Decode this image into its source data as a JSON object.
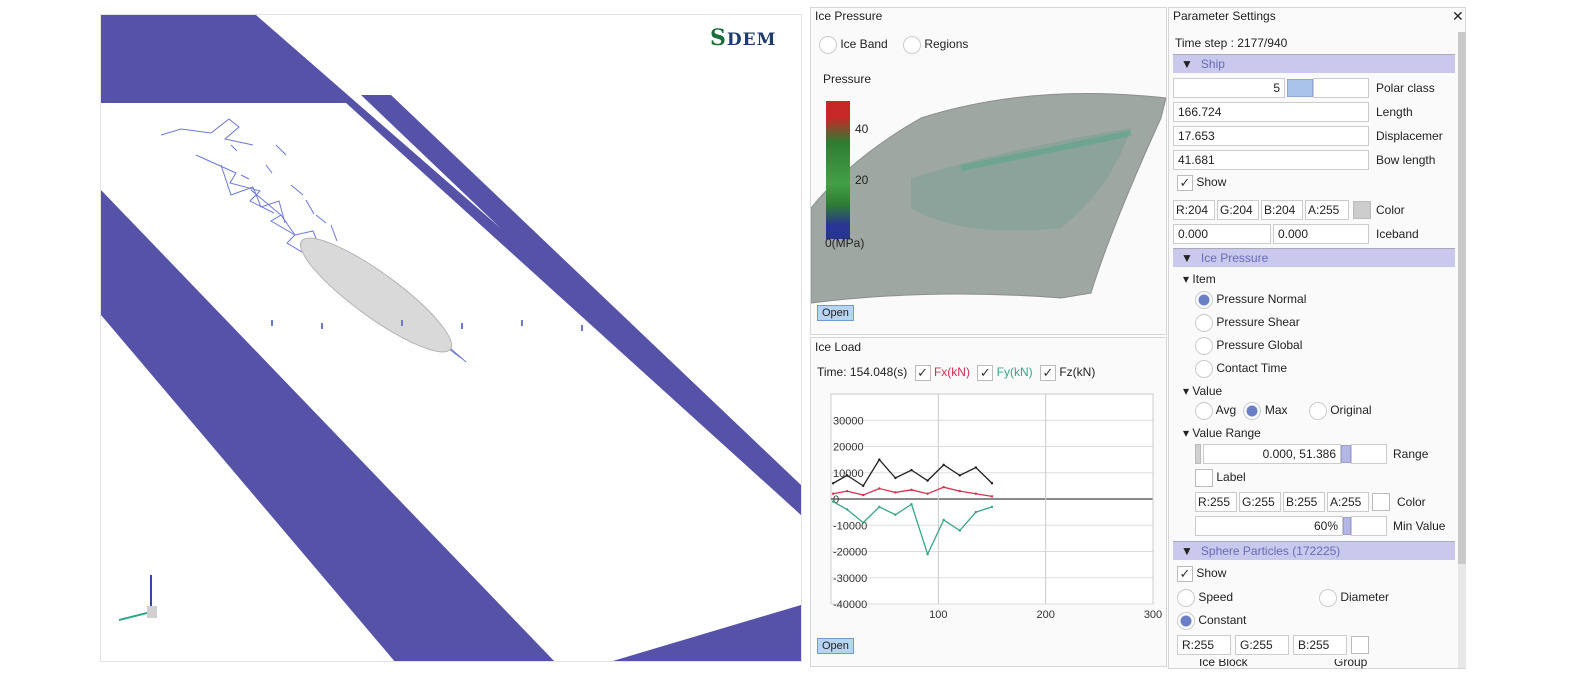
{
  "viewport": {
    "logo": {
      "text": "SDEM",
      "color_s": "#1c6b3a",
      "color_rest": "#1f3d6b"
    },
    "colors": {
      "water": "#5652a8",
      "ice": "#ffffff",
      "hull": "#d9d9d9",
      "particles": "#6a78d6"
    },
    "axes_icon": "axes-triad-icon"
  },
  "ice_pressure": {
    "title": "Ice Pressure",
    "options": [
      {
        "label": "Ice Band",
        "checked": false
      },
      {
        "label": "Regions",
        "checked": false
      }
    ],
    "legend_title": "Pressure",
    "legend_ticks": [
      "40",
      "20"
    ],
    "legend_unit": "0(MPa)",
    "open_label": "Open"
  },
  "ice_load": {
    "title": "Ice Load",
    "time_label": "Time: 154.048(s)",
    "series_labels": [
      {
        "label": "Fx(kN)",
        "checked": true,
        "color": "#d6304f"
      },
      {
        "label": "Fy(kN)",
        "checked": true,
        "color": "#3aa587"
      },
      {
        "label": "Fz(kN)",
        "checked": true,
        "color": "#222222"
      }
    ],
    "open_label": "Open"
  },
  "chart_data": {
    "type": "line",
    "title": "",
    "xlabel": "",
    "ylabel": "",
    "xlim": [
      0,
      300
    ],
    "ylim": [
      -40000,
      40000
    ],
    "x_ticks": [
      "100",
      "200",
      "300"
    ],
    "y_ticks": [
      "30000",
      "20000",
      "10000",
      "0",
      "-10000",
      "-20000",
      "-30000",
      "-40000"
    ],
    "grid": true,
    "series": [
      {
        "name": "Fx(kN)",
        "color": "#d6304f",
        "x": [
          2,
          15,
          30,
          45,
          60,
          75,
          90,
          105,
          120,
          135,
          150
        ],
        "y": [
          2000,
          3000,
          1500,
          4000,
          2500,
          3500,
          2000,
          4500,
          3000,
          2000,
          1000
        ]
      },
      {
        "name": "Fy(kN)",
        "color": "#3aa587",
        "x": [
          2,
          15,
          30,
          45,
          60,
          75,
          90,
          105,
          120,
          135,
          150
        ],
        "y": [
          -1000,
          -4000,
          -9000,
          -3000,
          -6000,
          -2000,
          -21000,
          -8000,
          -12000,
          -5000,
          -3000
        ]
      },
      {
        "name": "Fz(kN)",
        "color": "#222222",
        "x": [
          2,
          15,
          30,
          45,
          60,
          75,
          90,
          105,
          120,
          135,
          150
        ],
        "y": [
          6000,
          9000,
          5000,
          15000,
          8000,
          11000,
          7000,
          13000,
          9000,
          12000,
          6000
        ]
      }
    ]
  },
  "settings": {
    "title": "Parameter Settings",
    "close_icon": "close-icon",
    "time_step": "Time step : 2177/940",
    "ship": {
      "header": "Ship",
      "polar_class_value": "5",
      "polar_class_label": "Polar class",
      "length_value": "166.724",
      "length_label": "Length",
      "displacement_value": "17.653",
      "displacement_label": "Displacemer",
      "bow_length_value": "41.681",
      "bow_length_label": "Bow length",
      "show_label": "Show",
      "rgba": [
        "R:204",
        "G:204",
        "B:204",
        "A:255"
      ],
      "swatch_color": "#cccccc",
      "color_label": "Color",
      "iceband_values": [
        "0.000",
        "0.000"
      ],
      "iceband_label": "Iceband"
    },
    "ice_pressure": {
      "header": "Ice Pressure",
      "item_label": "Item",
      "items": [
        {
          "label": "Pressure Normal",
          "selected": true
        },
        {
          "label": "Pressure Shear",
          "selected": false
        },
        {
          "label": "Pressure Global",
          "selected": false
        },
        {
          "label": "Contact Time",
          "selected": false
        }
      ],
      "value_label": "Value",
      "value_options": [
        {
          "label": "Avg",
          "selected": false
        },
        {
          "label": "Max",
          "selected": true
        },
        {
          "label": "Original",
          "selected": false
        }
      ],
      "value_range_label": "Value Range",
      "range_value": "0.000, 51.386",
      "range_label": "Range",
      "label_label": "Label",
      "rgba": [
        "R:255",
        "G:255",
        "B:255",
        "A:255"
      ],
      "color_label": "Color",
      "min_value_value": "60%",
      "min_value_label": "Min Value"
    },
    "sphere_particles": {
      "header": "Sphere Particles (172225)",
      "show_label": "Show",
      "speed_label": "Speed",
      "diameter_label": "Diameter",
      "constant_label": "Constant",
      "rgb": [
        "R:255",
        "G:255",
        "B:255"
      ],
      "partial_labels": [
        "Ice Block",
        "Group"
      ]
    }
  }
}
